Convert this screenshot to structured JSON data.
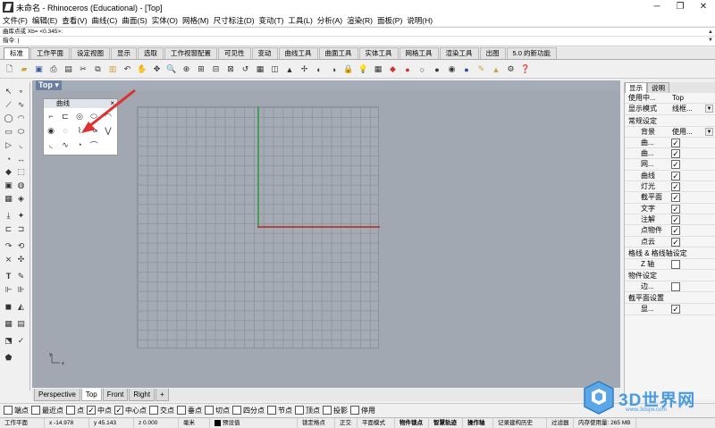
{
  "window": {
    "title": "未命名 - Rhinoceros (Educational) - [Top]",
    "controls": [
      "─",
      "❐",
      "✕"
    ]
  },
  "menu": [
    "文件(F)",
    "编辑(E)",
    "查看(V)",
    "曲线(C)",
    "曲面(S)",
    "实体(O)",
    "网格(M)",
    "尺寸标注(D)",
    "变动(T)",
    "工具(L)",
    "分析(A)",
    "渲染(R)",
    "面板(P)",
    "说明(H)"
  ],
  "command": {
    "history": "曲库点或 Xb= <0.345>:",
    "prompt": "指令:"
  },
  "toolbar_tabs": [
    "标准",
    "工作平面",
    "设定视图",
    "显示",
    "选取",
    "工作视窗配置",
    "可见性",
    "变动",
    "曲线工具",
    "曲面工具",
    "实体工具",
    "网格工具",
    "渲染工具",
    "出图",
    "5.0 的新功能"
  ],
  "active_toolbar_tab": "标准",
  "viewport": {
    "label": "Top",
    "axis_colors": {
      "x": "#b04545",
      "y": "#4d9a5a"
    },
    "origin_x": "x",
    "origin_y": "y"
  },
  "curve_panel": {
    "title": "曲线",
    "close": "×"
  },
  "viewport_tabs": [
    "Perspective",
    "Top",
    "Front",
    "Right",
    "+"
  ],
  "active_viewport_tab": "Top",
  "osnaps": [
    {
      "label": "端点",
      "checked": false
    },
    {
      "label": "最近点",
      "checked": false
    },
    {
      "label": "点",
      "checked": false
    },
    {
      "label": "中点",
      "checked": true
    },
    {
      "label": "中心点",
      "checked": true
    },
    {
      "label": "交点",
      "checked": false
    },
    {
      "label": "垂点",
      "checked": false
    },
    {
      "label": "切点",
      "checked": false
    },
    {
      "label": "四分点",
      "checked": false
    },
    {
      "label": "节点",
      "checked": false
    },
    {
      "label": "顶点",
      "checked": false
    },
    {
      "label": "投影",
      "checked": false
    },
    {
      "label": "停用",
      "checked": false
    }
  ],
  "status": {
    "cplane": "工作平面",
    "x": "x -14.978",
    "y": "y 45.143",
    "z": "z 0.000",
    "units": "毫米",
    "layer": "预设值",
    "lock_grid": "锁定格点",
    "ortho": "正交",
    "planar": "平面模式",
    "osnap": "物件锁点",
    "smarttrack": "智慧轨迹",
    "gumball": "操作轴",
    "history": "记录建构历史",
    "filter": "过滤器",
    "memory": "内存使用量: 265 MB"
  },
  "right_panel": {
    "tabs": [
      "显示",
      "说明"
    ],
    "rows": [
      {
        "k": "使用中...",
        "v": "Top"
      },
      {
        "k": "显示模式",
        "v": "线框..."
      }
    ],
    "section_general": "常规设定",
    "background_label": "背景",
    "background_value": "使用...",
    "items": [
      {
        "k": "曲..."
      },
      {
        "k": "曲..."
      },
      {
        "k": "网..."
      },
      {
        "k": "曲线"
      },
      {
        "k": "灯光"
      },
      {
        "k": "截平面"
      },
      {
        "k": "文字"
      },
      {
        "k": "注解"
      },
      {
        "k": "点物件"
      },
      {
        "k": "点云"
      }
    ],
    "section_grid": "格线 & 格线轴设定",
    "z_axis": "Z 轴",
    "section_object": "物件设定",
    "edge": "边...",
    "section_clip": "截平面设置",
    "display": "显...",
    "checkmark": "✓"
  },
  "logo": {
    "text": "3D世界网",
    "url": "www.3dsjw.com"
  }
}
